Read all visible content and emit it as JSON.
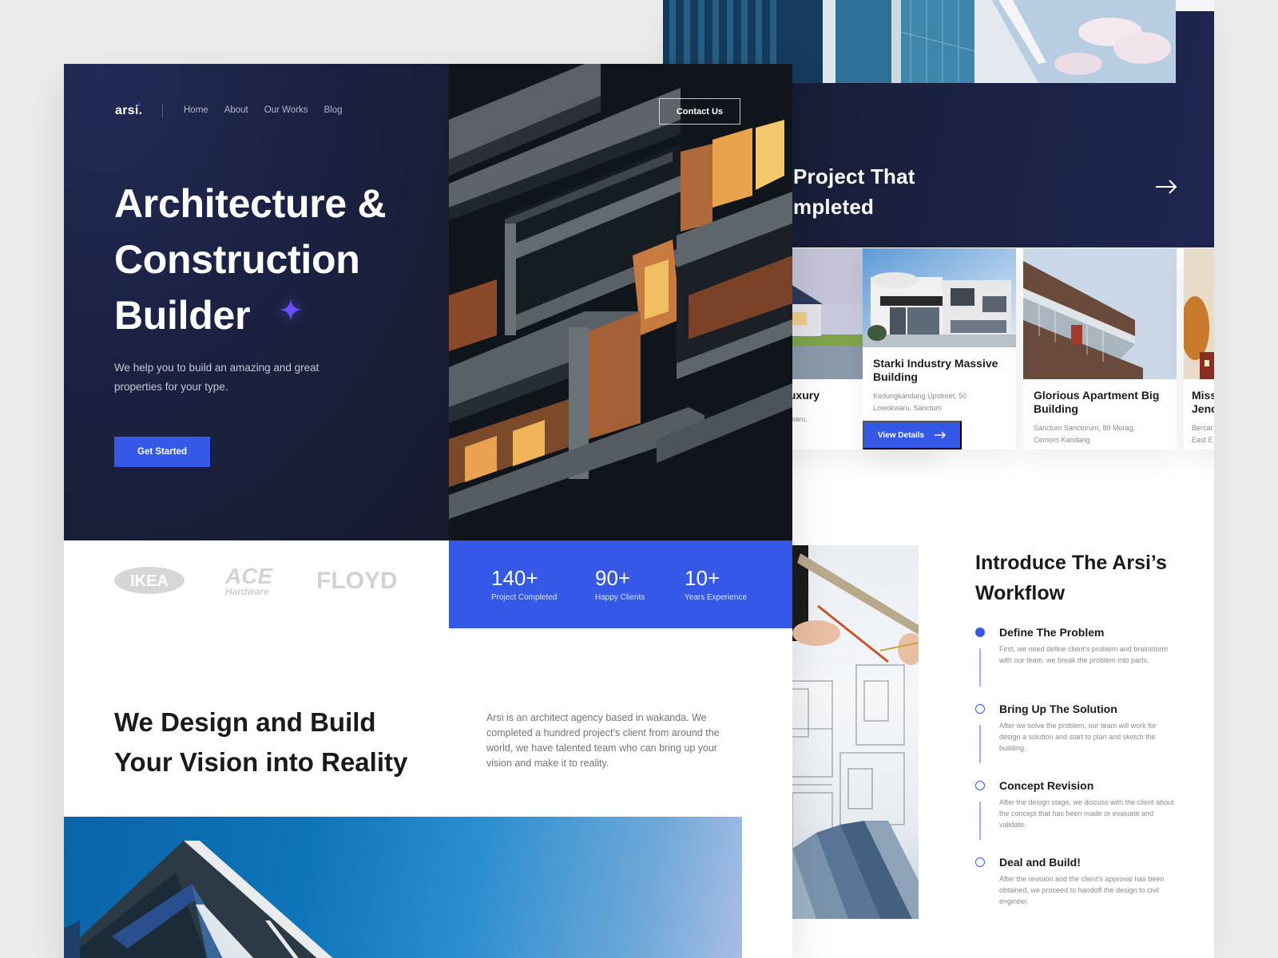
{
  "brand": {
    "logo": "arsi.",
    "accent": "#3559e6",
    "dark_bg": "#1b2142",
    "sparkle": "#6b4dff"
  },
  "nav": {
    "items": [
      {
        "label": "Home"
      },
      {
        "label": "About"
      },
      {
        "label": "Our Works"
      },
      {
        "label": "Blog"
      }
    ],
    "contact_label": "Contact Us"
  },
  "hero": {
    "title_lines": [
      "Architecture &",
      "Construction",
      "Builder"
    ],
    "description": "We help you to build an amazing and great properties for your type.",
    "cta_label": "Get Started",
    "image_alt": "Night view of modern apartment balconies with warm lit windows"
  },
  "partners": [
    {
      "name": "IKEA"
    },
    {
      "name": "ACE",
      "sub": "Hardware"
    },
    {
      "name": "FLOYD"
    }
  ],
  "stats": [
    {
      "value": "140+",
      "label": "Project Completed"
    },
    {
      "value": "90+",
      "label": "Happy Clients"
    },
    {
      "value": "10+",
      "label": "Years Experience"
    }
  ],
  "about": {
    "title_lines": [
      "We Design and Build",
      "Your Vision into Reality"
    ],
    "description": "Arsi is an architect agency based in wakanda. We completed a hundred project’s client from around the world, we have talented team who can bring up your vision and make it to reality."
  },
  "projects": {
    "heading_lines": [
      "Project That",
      "mpleted"
    ],
    "arrow_icon": "arrow-right-icon",
    "cards": [
      {
        "title": "ty Luxury",
        "address": "Lowokwaru."
      },
      {
        "title": "Starki Industry Massive Building",
        "address_lines": [
          "Kedungkandang Upstreet, 50",
          "Lowokwaru, Sanctum"
        ],
        "button_label": "View Details"
      },
      {
        "title": "Glorious Apartment Big Building",
        "address_lines": [
          "Sanctum Sanctorum, 89 Morag,",
          "Cemoro Kandang"
        ]
      },
      {
        "title_lines": [
          "Miss",
          "Jenc"
        ],
        "address_lines": [
          "Bercar",
          "East E"
        ]
      }
    ]
  },
  "workflow": {
    "title_lines": [
      "Introduce The Arsi’s",
      "Workflow"
    ],
    "steps": [
      {
        "title": "Define The Problem",
        "description": "First, we need define client’s problem and brainstorm with our team. we break the problem into parts.",
        "active": true
      },
      {
        "title": "Bring Up The Solution",
        "description": "After we solve the problem, our team will work for design a solution and start to plan and sketch the building.",
        "active": false
      },
      {
        "title": "Concept Revision",
        "description": "After the design stage, we discuss with the client about the concept that has been made or evaluate and validate.",
        "active": false
      },
      {
        "title": "Deal and Build!",
        "description": "After the revision and the client's approval has been obtained, we proceed to handoff the design to civil engineer.",
        "active": false
      }
    ]
  }
}
